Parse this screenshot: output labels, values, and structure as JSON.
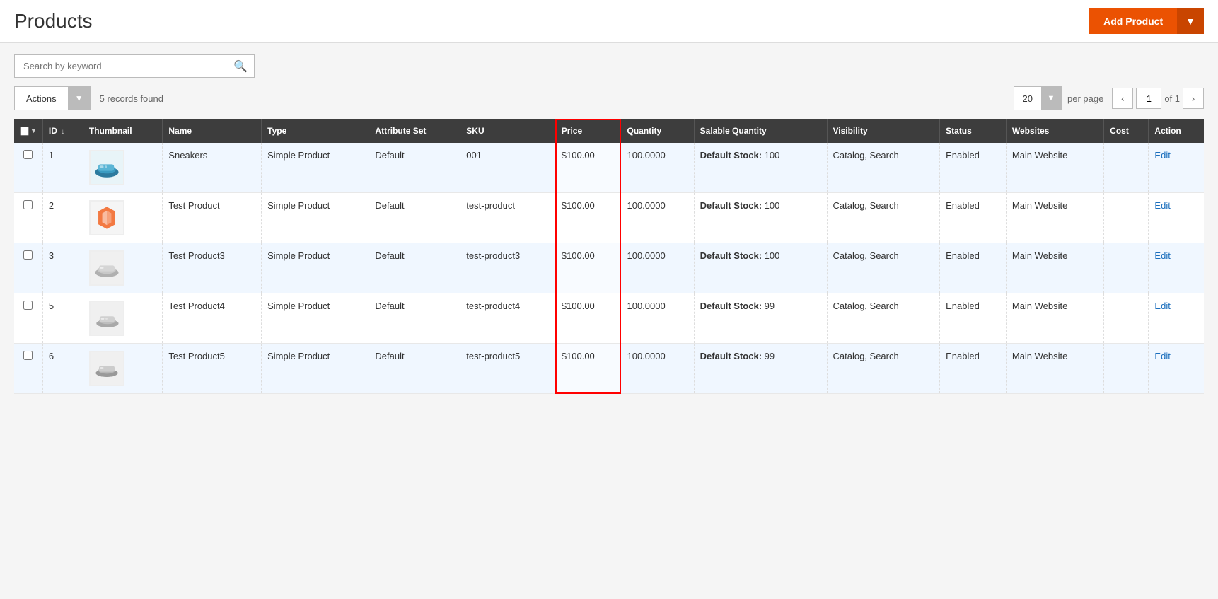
{
  "header": {
    "title": "Products",
    "add_button_label": "Add Product",
    "add_dropdown_label": "▼"
  },
  "search": {
    "placeholder": "Search by keyword",
    "icon": "🔍"
  },
  "toolbar": {
    "actions_label": "Actions",
    "records_found": "5 records found",
    "per_page_value": "20",
    "per_page_label": "per page",
    "page_current": "1",
    "page_total": "of 1"
  },
  "table": {
    "columns": [
      {
        "key": "checkbox",
        "label": ""
      },
      {
        "key": "id",
        "label": "ID"
      },
      {
        "key": "thumbnail",
        "label": "Thumbnail"
      },
      {
        "key": "name",
        "label": "Name"
      },
      {
        "key": "type",
        "label": "Type"
      },
      {
        "key": "attribute_set",
        "label": "Attribute Set"
      },
      {
        "key": "sku",
        "label": "SKU"
      },
      {
        "key": "price",
        "label": "Price"
      },
      {
        "key": "quantity",
        "label": "Quantity"
      },
      {
        "key": "salable_quantity",
        "label": "Salable Quantity"
      },
      {
        "key": "visibility",
        "label": "Visibility"
      },
      {
        "key": "status",
        "label": "Status"
      },
      {
        "key": "websites",
        "label": "Websites"
      },
      {
        "key": "cost",
        "label": "Cost"
      },
      {
        "key": "action",
        "label": "Action"
      }
    ],
    "rows": [
      {
        "id": "1",
        "name": "Sneakers",
        "type": "Simple Product",
        "attribute_set": "Default",
        "sku": "001",
        "price": "$100.00",
        "quantity": "100.0000",
        "salable_quantity": "Default Stock: 100",
        "visibility": "Catalog, Search",
        "status": "Enabled",
        "websites": "Main Website",
        "cost": "",
        "action": "Edit",
        "thumbnail_type": "sneakers"
      },
      {
        "id": "2",
        "name": "Test Product",
        "type": "Simple Product",
        "attribute_set": "Default",
        "sku": "test-product",
        "price": "$100.00",
        "quantity": "100.0000",
        "salable_quantity": "Default Stock: 100",
        "visibility": "Catalog, Search",
        "status": "Enabled",
        "websites": "Main Website",
        "cost": "",
        "action": "Edit",
        "thumbnail_type": "magento"
      },
      {
        "id": "3",
        "name": "Test Product3",
        "type": "Simple Product",
        "attribute_set": "Default",
        "sku": "test-product3",
        "price": "$100.00",
        "quantity": "100.0000",
        "salable_quantity": "Default Stock: 100",
        "visibility": "Catalog, Search",
        "status": "Enabled",
        "websites": "Main Website",
        "cost": "",
        "action": "Edit",
        "thumbnail_type": "shoe_gray"
      },
      {
        "id": "5",
        "name": "Test Product4",
        "type": "Simple Product",
        "attribute_set": "Default",
        "sku": "test-product4",
        "price": "$100.00",
        "quantity": "100.0000",
        "salable_quantity": "Default Stock: 99",
        "visibility": "Catalog, Search",
        "status": "Enabled",
        "websites": "Main Website",
        "cost": "",
        "action": "Edit",
        "thumbnail_type": "shoe_gray2"
      },
      {
        "id": "6",
        "name": "Test Product5",
        "type": "Simple Product",
        "attribute_set": "Default",
        "sku": "test-product5",
        "price": "$100.00",
        "quantity": "100.0000",
        "salable_quantity": "Default Stock: 99",
        "visibility": "Catalog, Search",
        "status": "Enabled",
        "websites": "Main Website",
        "cost": "",
        "action": "Edit",
        "thumbnail_type": "shoe_gray3"
      }
    ]
  }
}
